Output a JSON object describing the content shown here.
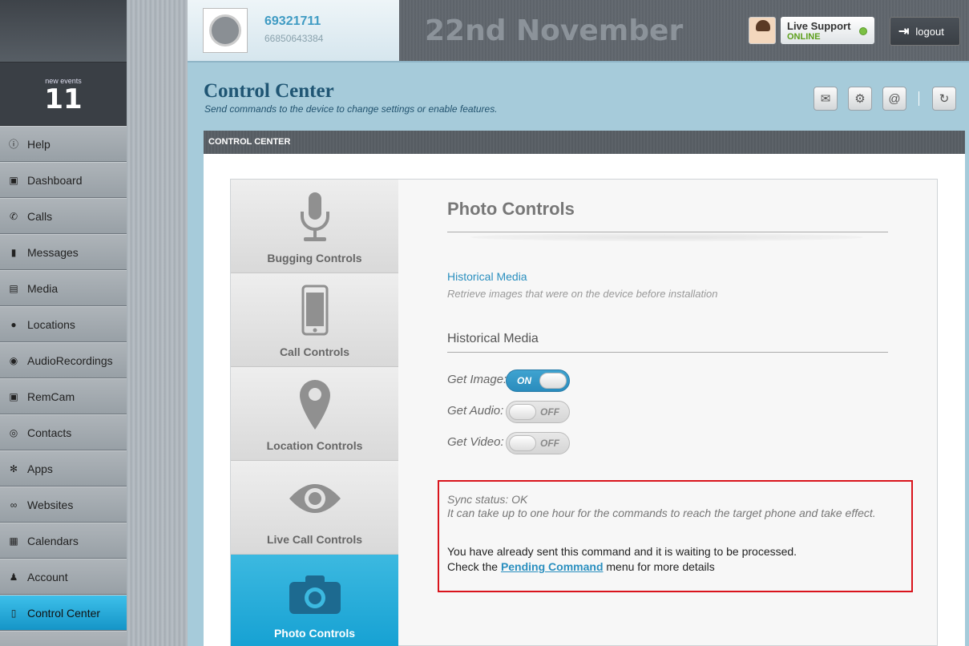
{
  "sidebar": {
    "events_label": "new events",
    "events_count": "11",
    "items": [
      {
        "label": "Help",
        "icon": "info-icon"
      },
      {
        "label": "Dashboard",
        "icon": "camera-icon"
      },
      {
        "label": "Calls",
        "icon": "phone-icon"
      },
      {
        "label": "Messages",
        "icon": "message-icon"
      },
      {
        "label": "Media",
        "icon": "image-icon"
      },
      {
        "label": "Locations",
        "icon": "pin-icon"
      },
      {
        "label": "AudioRecordings",
        "icon": "microphone-icon"
      },
      {
        "label": "RemCam",
        "icon": "camera-icon"
      },
      {
        "label": "Contacts",
        "icon": "contact-icon"
      },
      {
        "label": "Apps",
        "icon": "gear-icon"
      },
      {
        "label": "Websites",
        "icon": "link-icon"
      },
      {
        "label": "Calendars",
        "icon": "calendar-icon"
      },
      {
        "label": "Account",
        "icon": "user-icon"
      },
      {
        "label": "Control Center",
        "icon": "tablet-icon",
        "active": true
      }
    ]
  },
  "header": {
    "device_name": "69321711",
    "device_number": "66850643384",
    "date": "22nd November",
    "support_title": "Live Support",
    "support_status": "ONLINE",
    "logout_label": "logout"
  },
  "page": {
    "title": "Control Center",
    "subtitle": "Send commands to the device to change settings or enable features.",
    "panel_title": "CONTROL CENTER"
  },
  "tabs": [
    {
      "label": "Bugging Controls",
      "icon": "microphone-icon"
    },
    {
      "label": "Call Controls",
      "icon": "phone-icon"
    },
    {
      "label": "Location Controls",
      "icon": "location-pin-icon"
    },
    {
      "label": "Live Call Controls",
      "icon": "eye-icon"
    },
    {
      "label": "Photo Controls",
      "icon": "camera-icon",
      "active": true
    }
  ],
  "photo_controls": {
    "title": "Photo Controls",
    "link_label": "Historical Media",
    "link_desc": "Retrieve images that were on the device before installation",
    "section_title": "Historical Media",
    "options": [
      {
        "label": "Get Image:",
        "state": "ON"
      },
      {
        "label": "Get Audio:",
        "state": "OFF"
      },
      {
        "label": "Get Video:",
        "state": "OFF"
      }
    ],
    "sync_status": "Sync status: OK",
    "sync_note": "It can take up to one hour for the commands to reach the target phone and take effect.",
    "msg_line1": "You have already sent this command and it is waiting to be processed.",
    "msg_line2_pre": "Check the ",
    "msg_link": "Pending Command",
    "msg_line2_post": " menu for more details"
  },
  "colors": {
    "accent": "#16a1d3",
    "title": "#1f5573",
    "alert_border": "#d9141c",
    "online": "#7bc043"
  }
}
